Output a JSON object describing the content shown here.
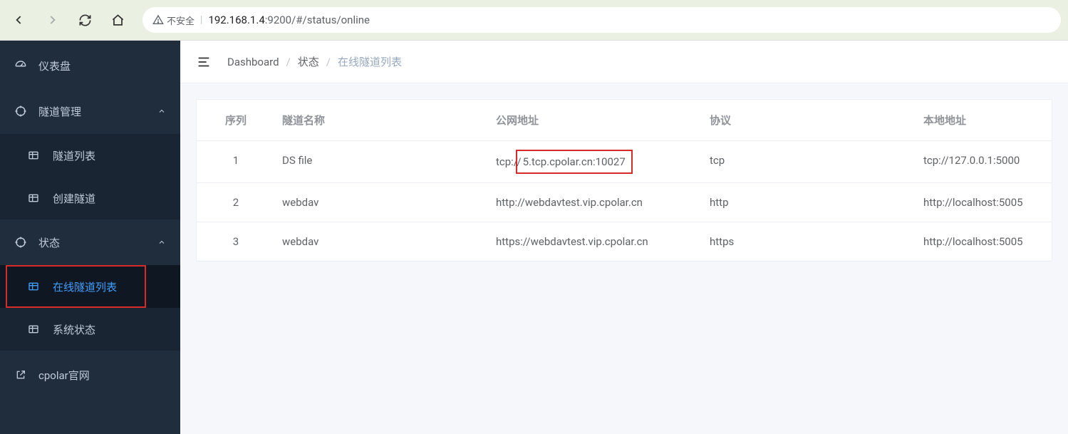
{
  "browser": {
    "security_label": "不安全",
    "url_host": "192.168.1.4",
    "url_port_path": ":9200/#/status/online"
  },
  "sidebar": {
    "dashboard": "仪表盘",
    "tunnel_mgmt": "隧道管理",
    "tunnel_list": "隧道列表",
    "tunnel_create": "创建隧道",
    "status": "状态",
    "online_list": "在线隧道列表",
    "sys_status": "系统状态",
    "official": "cpolar官网"
  },
  "breadcrumb": {
    "a": "Dashboard",
    "b": "状态",
    "c": "在线隧道列表"
  },
  "table": {
    "headers": {
      "seq": "序列",
      "name": "隧道名称",
      "pub": "公网地址",
      "proto": "协议",
      "local": "本地地址"
    },
    "rows": [
      {
        "seq": "1",
        "name": "DS file",
        "pub_pre": "tcp://",
        "pub_hi": "5.tcp.cpolar.cn:10027",
        "proto": "tcp",
        "local": "tcp://127.0.0.1:5000"
      },
      {
        "seq": "2",
        "name": "webdav",
        "pub": "http://webdavtest.vip.cpolar.cn",
        "proto": "http",
        "local": "http://localhost:5005"
      },
      {
        "seq": "3",
        "name": "webdav",
        "pub": "https://webdavtest.vip.cpolar.cn",
        "proto": "https",
        "local": "http://localhost:5005"
      }
    ]
  }
}
